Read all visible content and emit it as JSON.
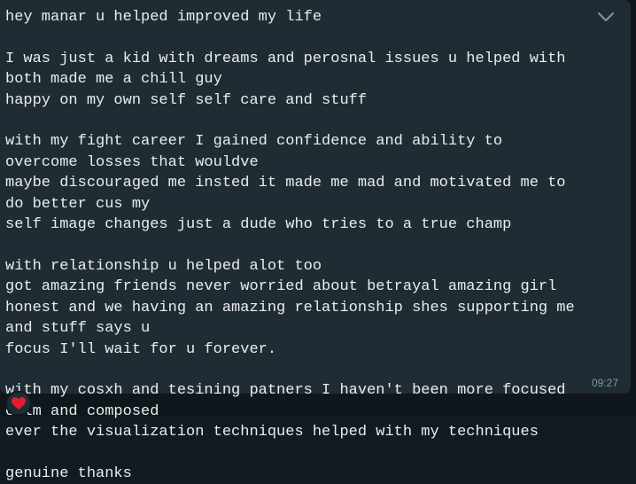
{
  "message": {
    "lines": [
      "hey manar u helped improved my life",
      "",
      "I was just a kid with dreams and perosnal issues u helped with both made me a chill guy",
      "happy on my own self self care and stuff",
      "",
      "with my fight career I gained confidence and ability to overcome losses that wouldve",
      "maybe discouraged me insted it made me mad and motivated me to do better cus my",
      "self image changes just a dude who tries to a true champ",
      "",
      "with relationship u helped alot too",
      "got amazing friends never worried about betrayal amazing girl",
      "honest and we having an amazing relationship shes supporting me and stuff says u",
      "focus I'll wait for u forever.",
      "",
      "with my cosxh and tesining patners I haven't been more focused calm and composed",
      "ever the visualization techniques helped with my techniques",
      "",
      "genuine thanks"
    ],
    "time": "09:27",
    "reaction": "❤️"
  },
  "icons": {
    "menu_chevron": "chevron-down-icon",
    "reaction": "heart-reaction-icon"
  },
  "colors": {
    "bubble": "#202c33",
    "background": "#111b21",
    "text": "#e9edef",
    "meta": "#8696a0",
    "heart": "#e11d2e"
  }
}
